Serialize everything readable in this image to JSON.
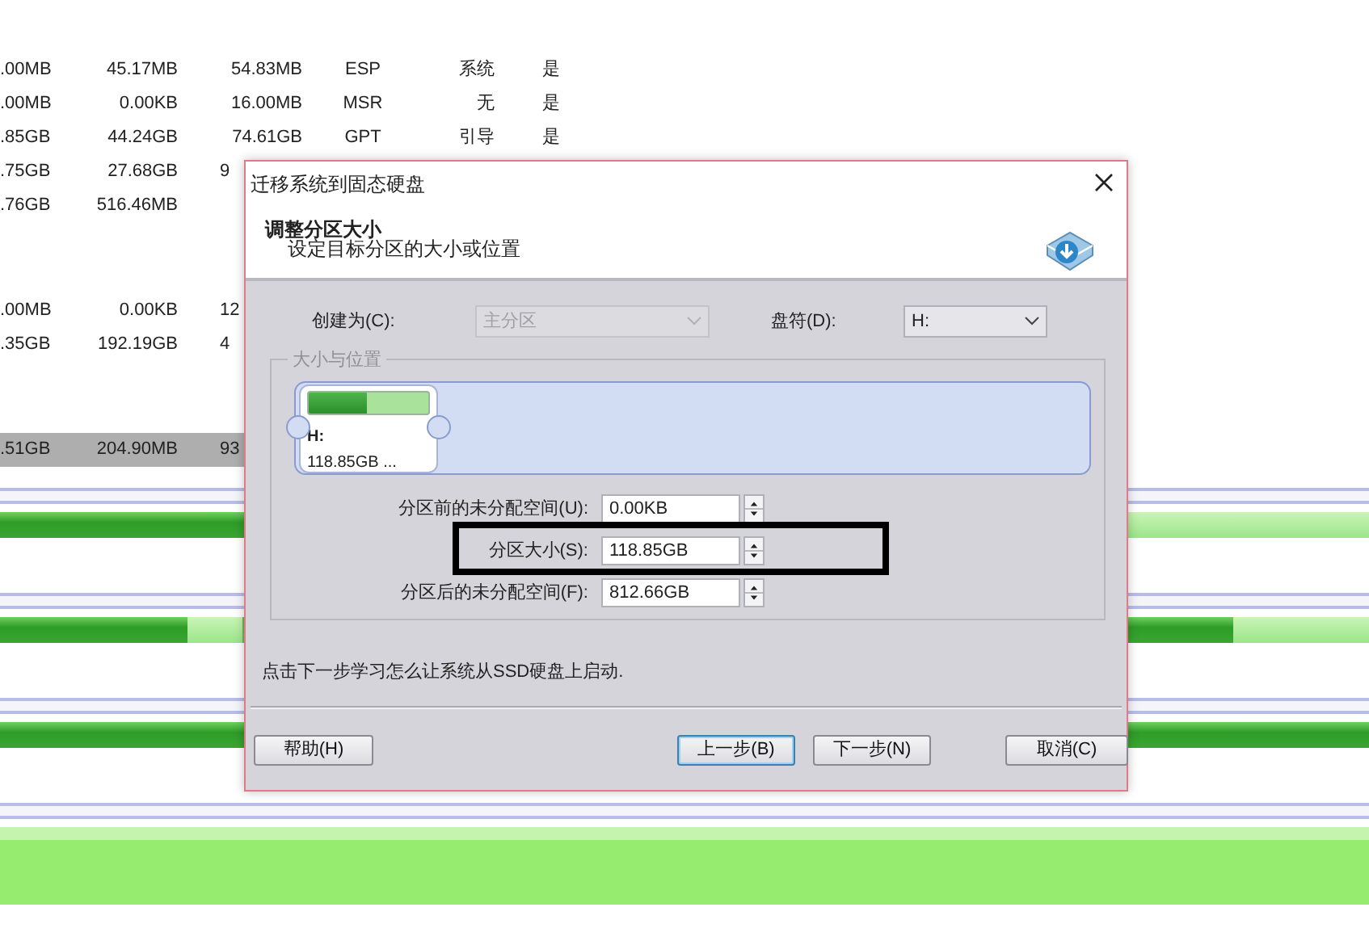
{
  "background_table": {
    "groups": [
      {
        "rows": [
          {
            "selected": false,
            "cells": [
              ".00MB",
              "45.17MB",
              "54.83MB",
              "ESP",
              "系统",
              "是"
            ]
          },
          {
            "selected": false,
            "cells": [
              ".00MB",
              "0.00KB",
              "16.00MB",
              "MSR",
              "无",
              "是"
            ]
          },
          {
            "selected": false,
            "cells": [
              ".85GB",
              "44.24GB",
              "74.61GB",
              "GPT",
              "引导",
              "是"
            ]
          },
          {
            "selected": false,
            "cells": [
              ".75GB",
              "27.68GB",
              "9"
            ]
          },
          {
            "selected": false,
            "cells": [
              ".76GB",
              "516.46MB"
            ]
          }
        ]
      },
      {
        "rows": [
          {
            "selected": false,
            "cells": [
              ".00MB",
              "0.00KB",
              "12"
            ]
          },
          {
            "selected": false,
            "cells": [
              ".35GB",
              "192.19GB",
              "4"
            ]
          }
        ]
      },
      {
        "rows": [
          {
            "selected": true,
            "cells": [
              ".51GB",
              "204.90MB",
              "93"
            ]
          }
        ]
      }
    ]
  },
  "disk_bars": [
    {
      "segments": [
        {
          "level": 0.6
        }
      ]
    },
    {
      "segments": [
        {
          "level": 0.77
        },
        {
          "level": 0.88
        }
      ]
    },
    {
      "segments": [
        {
          "level": 1
        }
      ]
    },
    {
      "segments": [
        {
          "level": 0
        }
      ]
    }
  ],
  "dialog": {
    "title": "迁移系统到固态硬盘",
    "heading": "调整分区大小",
    "subheading": "设定目标分区的大小或位置",
    "create_as": {
      "label": "创建为(C):",
      "value": "主分区",
      "disabled": true
    },
    "drive_letter": {
      "label": "盘符(D):",
      "value": "H:",
      "disabled": false
    },
    "group_title": "大小与位置",
    "partition": {
      "letter": "H:",
      "size": "118.85GB ...",
      "level": 0.49
    },
    "spin_fields": [
      {
        "label": "分区前的未分配空间(U):",
        "value": "0.00KB",
        "highlighted": false
      },
      {
        "label": "分区大小(S):",
        "value": "118.85GB",
        "highlighted": true
      },
      {
        "label": "分区后的未分配空间(F):",
        "value": "812.66GB",
        "highlighted": false
      }
    ],
    "hint": "点击下一步学习怎么让系统从SSD硬盘上启动.",
    "buttons": [
      {
        "label": "帮助(H)",
        "kind": "left",
        "focused": false
      },
      {
        "label": "上一步(B)",
        "kind": "right",
        "focused": true
      },
      {
        "label": "下一步(N)",
        "kind": "right",
        "focused": false
      },
      {
        "label": "取消(C)",
        "kind": "far",
        "focused": false
      }
    ]
  }
}
